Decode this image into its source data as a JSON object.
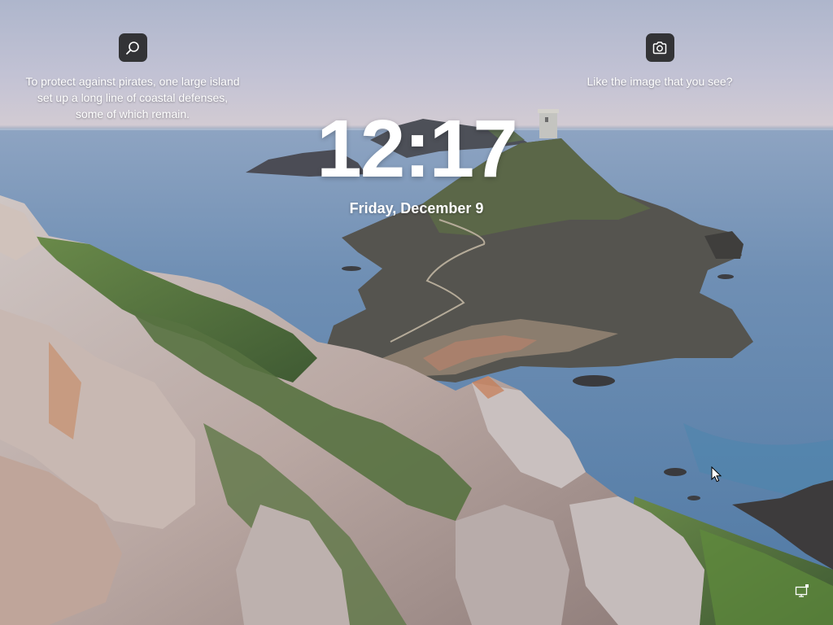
{
  "lockscreen": {
    "fact_widget": {
      "icon": "search-icon",
      "text": "To protect against pirates, one large island set up a long line of coastal defenses, some of which remain."
    },
    "like_widget": {
      "icon": "camera-icon",
      "text": "Like the image that you see?"
    },
    "clock": {
      "time": "12:17",
      "date": "Friday, December 9"
    },
    "status": {
      "network_icon": "network-icon"
    },
    "colors": {
      "text": "#ffffff",
      "widget_button_bg": "#202020"
    }
  }
}
